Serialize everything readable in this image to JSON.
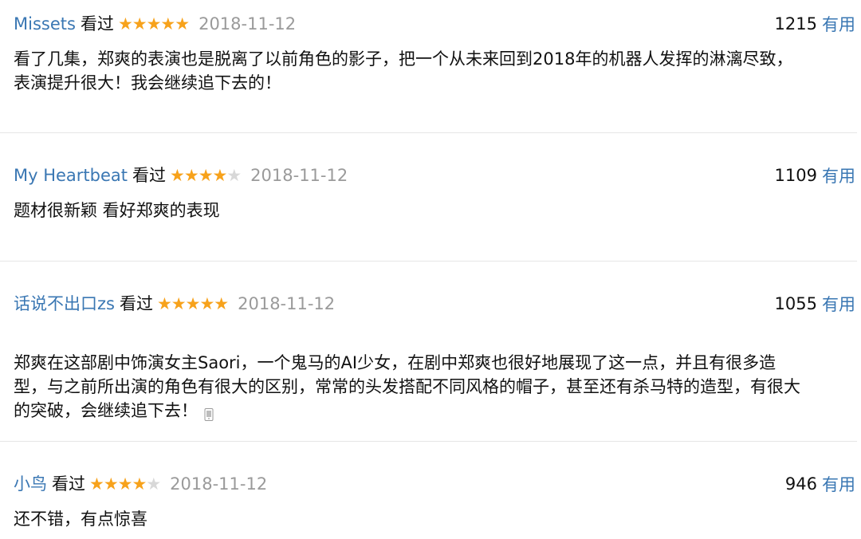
{
  "reviews": [
    {
      "user": "Missets",
      "status": "看过",
      "stars": 5,
      "date": "2018-11-12",
      "votes": "1215",
      "useful_label": "有用",
      "content": "看了几集，郑爽的表演也是脱离了以前角色的影子，把一个从未来回到2018年的机器人发挥的淋漓尽致，\n表演提升很大！我会继续追下去的！"
    },
    {
      "user": "My Heartbeat",
      "status": "看过",
      "stars": 4,
      "date": "2018-11-12",
      "votes": "1109",
      "useful_label": "有用",
      "content": "题材很新颖 看好郑爽的表现"
    },
    {
      "user": "话说不出口zs",
      "status": "看过",
      "stars": 5,
      "date": "2018-11-12",
      "votes": "1055",
      "useful_label": "有用",
      "content": "郑爽在这部剧中饰演女主Saori，一个鬼马的AI少女，在剧中郑爽也很好地展现了这一点，并且有很多造\n型，与之前所出演的角色有很大的区别，常常的头发搭配不同风格的帽子，甚至还有杀马特的造型，有很大\n的突破，会继续追下去！"
    },
    {
      "user": "小鸟",
      "status": "看过",
      "stars": 4,
      "date": "2018-11-12",
      "votes": "946",
      "useful_label": "有用",
      "content": "还不错，有点惊喜"
    }
  ],
  "icons": {
    "star": "★",
    "mobile": "mobile-icon"
  },
  "colors": {
    "link": "#3a77b3",
    "star_on": "#f7a21b",
    "star_off": "#d8d8d8",
    "date": "#9a9a9a",
    "divider": "#e6e6e6"
  }
}
